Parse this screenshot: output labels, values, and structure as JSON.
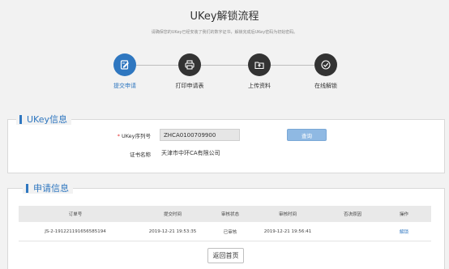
{
  "header": {
    "title": "UKey解锁流程",
    "subtitle": "请确保您的UKey已经安装了我们的数字证书，解锁完成后UKey密码为初始密码。"
  },
  "steps": [
    {
      "label": "提交申请",
      "icon": "edit-document-icon",
      "active": true
    },
    {
      "label": "打印申请表",
      "icon": "printer-icon",
      "active": false
    },
    {
      "label": "上传资料",
      "icon": "upload-folder-icon",
      "active": false
    },
    {
      "label": "在线解锁",
      "icon": "check-circle-icon",
      "active": false
    }
  ],
  "ukey_section": {
    "title": "UKey信息",
    "serial_label": "UKey序列号",
    "serial_required_mark": "*",
    "serial_value": "ZHCA0100709900",
    "query_button": "查询",
    "cert_name_label": "证书名称",
    "cert_name_value": "天津市中环CA有限公司"
  },
  "application_section": {
    "title": "申请信息",
    "columns": [
      "订单号",
      "提交时间",
      "审核状态",
      "审核时间",
      "否决原因",
      "操作"
    ],
    "rows": [
      {
        "order_no": "JS-2-191221191656585194",
        "submit_time": "2019-12-21 19:53:35",
        "status": "已审核",
        "review_time": "2019-12-21 19:56:41",
        "reject_reason": "",
        "action": "解锁"
      }
    ]
  },
  "footer": {
    "back_button": "返回首页"
  },
  "colors": {
    "accent": "#2f77c0",
    "step_inactive": "#333333",
    "required": "#e23232"
  }
}
